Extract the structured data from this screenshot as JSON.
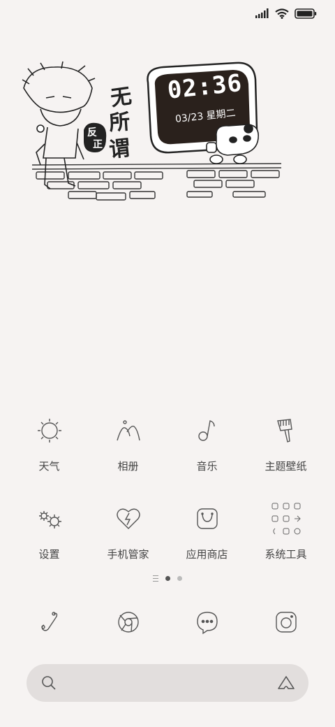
{
  "status_bar": {
    "signal_icon": "cellular-signal-icon",
    "wifi_icon": "wifi-icon",
    "battery_icon": "battery-full-icon"
  },
  "widget": {
    "time": "02:36",
    "date": "03/23 星期二",
    "calligraphy": [
      "无",
      "所",
      "谓",
      "反",
      "正"
    ]
  },
  "apps": [
    [
      {
        "label": "天气",
        "icon": "sun-icon"
      },
      {
        "label": "相册",
        "icon": "mountain-icon"
      },
      {
        "label": "音乐",
        "icon": "music-note-icon"
      },
      {
        "label": "主题壁纸",
        "icon": "paint-brush-icon"
      }
    ],
    [
      {
        "label": "设置",
        "icon": "gears-icon"
      },
      {
        "label": "手机管家",
        "icon": "heart-shield-icon"
      },
      {
        "label": "应用商店",
        "icon": "shopping-bag-icon"
      },
      {
        "label": "系统工具",
        "icon": "folder-grid-icon"
      }
    ]
  ],
  "page_indicator": {
    "pages": 2,
    "active_index": 0
  },
  "dock": [
    {
      "icon": "phone-icon"
    },
    {
      "icon": "browser-icon"
    },
    {
      "icon": "messages-icon"
    },
    {
      "icon": "camera-icon"
    }
  ],
  "search": {
    "placeholder": "",
    "search_icon": "search-icon",
    "assistant_icon": "assistant-icon"
  }
}
